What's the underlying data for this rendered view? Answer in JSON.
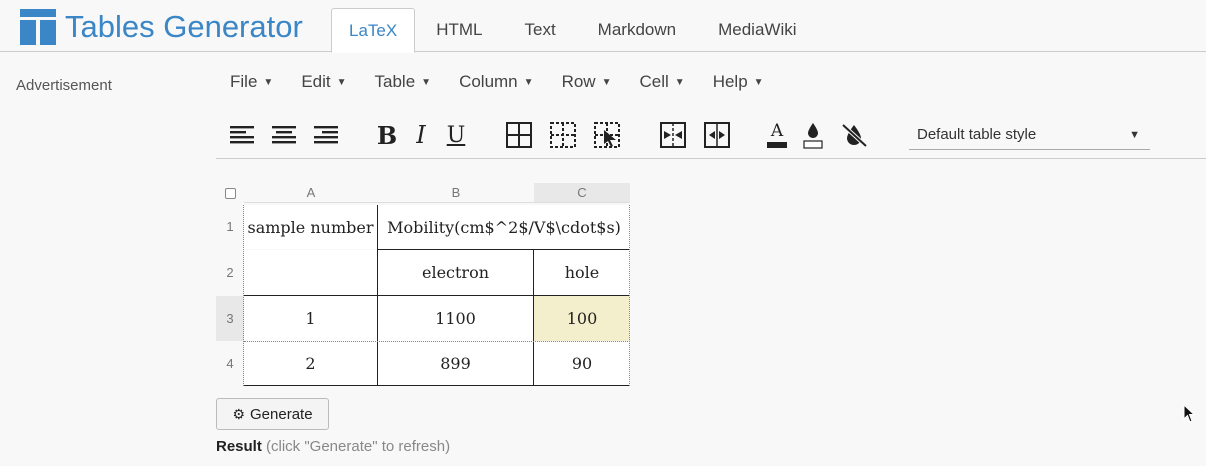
{
  "app": {
    "title": "Tables Generator",
    "brand_color": "#3a86c6"
  },
  "tabs": [
    {
      "label": "LaTeX",
      "active": true
    },
    {
      "label": "HTML",
      "active": false
    },
    {
      "label": "Text",
      "active": false
    },
    {
      "label": "Markdown",
      "active": false
    },
    {
      "label": "MediaWiki",
      "active": false
    }
  ],
  "advertisement": "Advertisement",
  "menu": [
    "File",
    "Edit",
    "Table",
    "Column",
    "Row",
    "Cell",
    "Help"
  ],
  "toolbar": {
    "buttons": [
      "align-left-icon",
      "align-center-icon",
      "align-right-icon",
      "bold-icon",
      "italic-icon",
      "underline-icon",
      "all-borders-icon",
      "dotted-borders-icon",
      "select-borders-icon",
      "merge-cells-icon",
      "split-cells-icon",
      "text-color-icon",
      "background-color-icon",
      "clear-format-icon"
    ],
    "bold": "B",
    "italic": "I",
    "underline": "U",
    "text_color_letter": "A",
    "table_style": "Default table style"
  },
  "grid": {
    "columns": [
      "A",
      "B",
      "C"
    ],
    "rows": [
      "1",
      "2",
      "3",
      "4"
    ],
    "selected_column": "C",
    "selected_row": "3",
    "cells": {
      "r1": [
        "sample number",
        "Mobility(cm$^2$/V$\\cdot$s)"
      ],
      "r2": [
        "electron",
        "hole"
      ],
      "r3": [
        "1",
        "1100",
        "100"
      ],
      "r4": [
        "2",
        "899",
        "90"
      ]
    },
    "selected_cell_color": "#f3efcc"
  },
  "generate_button": "Generate",
  "result": {
    "label": "Result",
    "hint": "(click \"Generate\" to refresh)"
  }
}
